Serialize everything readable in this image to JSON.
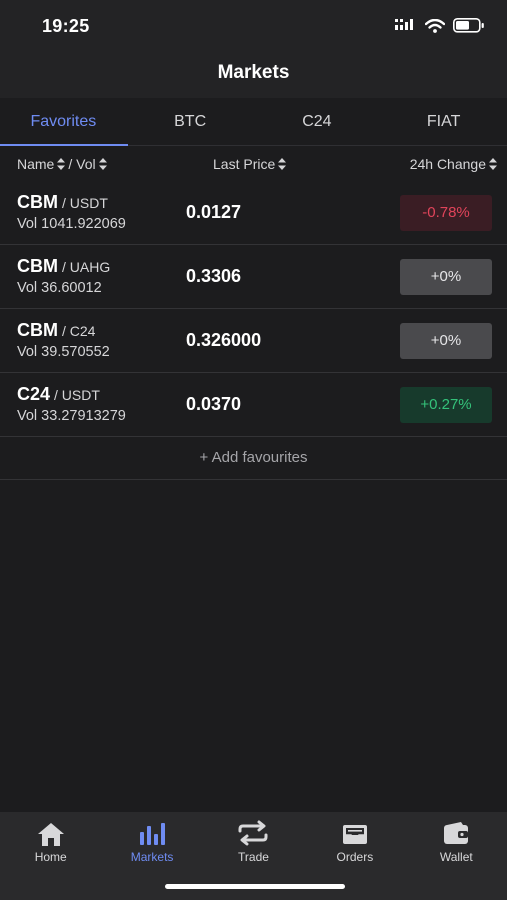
{
  "status": {
    "time": "19:25"
  },
  "title": "Markets",
  "tabs": [
    {
      "label": "Favorites",
      "active": true
    },
    {
      "label": "BTC",
      "active": false
    },
    {
      "label": "C24",
      "active": false
    },
    {
      "label": "FIAT",
      "active": false
    }
  ],
  "columns": {
    "name": "Name",
    "vol": "/ Vol",
    "last_price": "Last Price",
    "change": "24h Change"
  },
  "rows": [
    {
      "base": "CBM",
      "quote": "/ USDT",
      "vol": "Vol 1041.922069",
      "price": "0.0127",
      "change": "-0.78%",
      "trend": "neg"
    },
    {
      "base": "CBM",
      "quote": "/ UAHG",
      "vol": "Vol 36.60012",
      "price": "0.3306",
      "change": "+0%",
      "trend": "flat"
    },
    {
      "base": "CBM",
      "quote": "/ C24",
      "vol": "Vol 39.570552",
      "price": "0.326000",
      "change": "+0%",
      "trend": "flat"
    },
    {
      "base": "C24",
      "quote": "/ USDT",
      "vol": "Vol 33.27913279",
      "price": "0.0370",
      "change": "+0.27%",
      "trend": "pos"
    }
  ],
  "add_favourites": "+ Add favourites",
  "nav": [
    {
      "label": "Home",
      "icon": "home-icon",
      "active": false
    },
    {
      "label": "Markets",
      "icon": "bar-chart-icon",
      "active": true
    },
    {
      "label": "Trade",
      "icon": "swap-icon",
      "active": false
    },
    {
      "label": "Orders",
      "icon": "inbox-icon",
      "active": false
    },
    {
      "label": "Wallet",
      "icon": "wallet-icon",
      "active": false
    }
  ],
  "colors": {
    "accent": "#6f8cf2",
    "negative": "#e0445a",
    "positive": "#34c27a",
    "background": "#1c1c1e"
  }
}
